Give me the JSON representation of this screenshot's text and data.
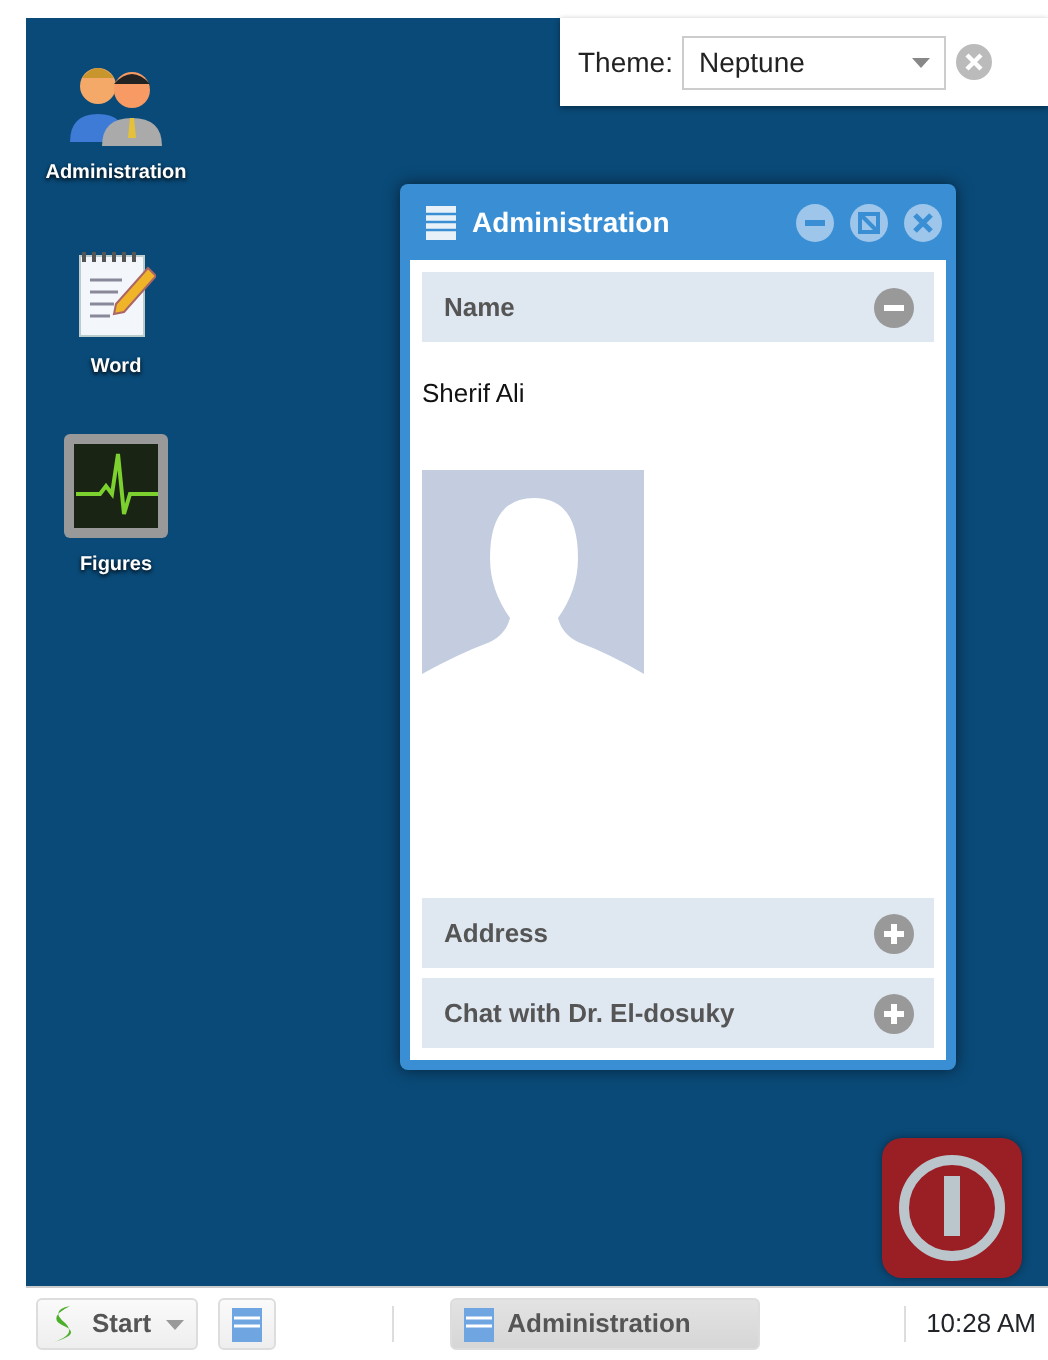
{
  "theme": {
    "label": "Theme:",
    "value": "Neptune"
  },
  "desktop_icons": [
    {
      "kind": "users",
      "label": "Administration"
    },
    {
      "kind": "notepad",
      "label": "Word"
    },
    {
      "kind": "monitor",
      "label": "Figures"
    }
  ],
  "window": {
    "title": "Administration",
    "panels": [
      {
        "title": "Name",
        "expanded": true,
        "content": "Sherif Ali"
      },
      {
        "title": "Address",
        "expanded": false
      },
      {
        "title": "Chat with Dr. El-dosuky",
        "expanded": false
      }
    ]
  },
  "taskbar": {
    "start": "Start",
    "tasks": [
      {
        "label": "Administration",
        "selected": true
      }
    ],
    "clock": "10:28 AM"
  }
}
